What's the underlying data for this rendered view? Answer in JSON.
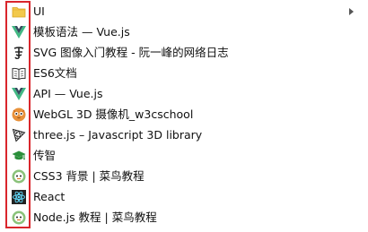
{
  "colors": {
    "highlight": "#d9262c",
    "vue_green": "#41b883",
    "vue_dark": "#35495e"
  },
  "items": [
    {
      "label": "UI",
      "icon": "folder-icon",
      "has_submenu": true
    },
    {
      "label": "模板语法 — Vue.js",
      "icon": "vue-logo-icon"
    },
    {
      "label": "SVG 图像入门教程 - 阮一峰的网络日志",
      "icon": "ruanyf-logo-icon"
    },
    {
      "label": "ES6文档",
      "icon": "book-icon"
    },
    {
      "label": "API — Vue.js",
      "icon": "vue-logo-icon"
    },
    {
      "label": "WebGL 3D 摄像机_w3cschool",
      "icon": "w3cschool-icon"
    },
    {
      "label": "three.js – Javascript 3D library",
      "icon": "threejs-logo-icon"
    },
    {
      "label": "传智",
      "icon": "graduation-cap-icon"
    },
    {
      "label": "CSS3 背景 | 菜鸟教程",
      "icon": "runoob-icon"
    },
    {
      "label": "React",
      "icon": "react-logo-icon"
    },
    {
      "label": "Node.js 教程 | 菜鸟教程",
      "icon": "runoob-icon"
    }
  ]
}
